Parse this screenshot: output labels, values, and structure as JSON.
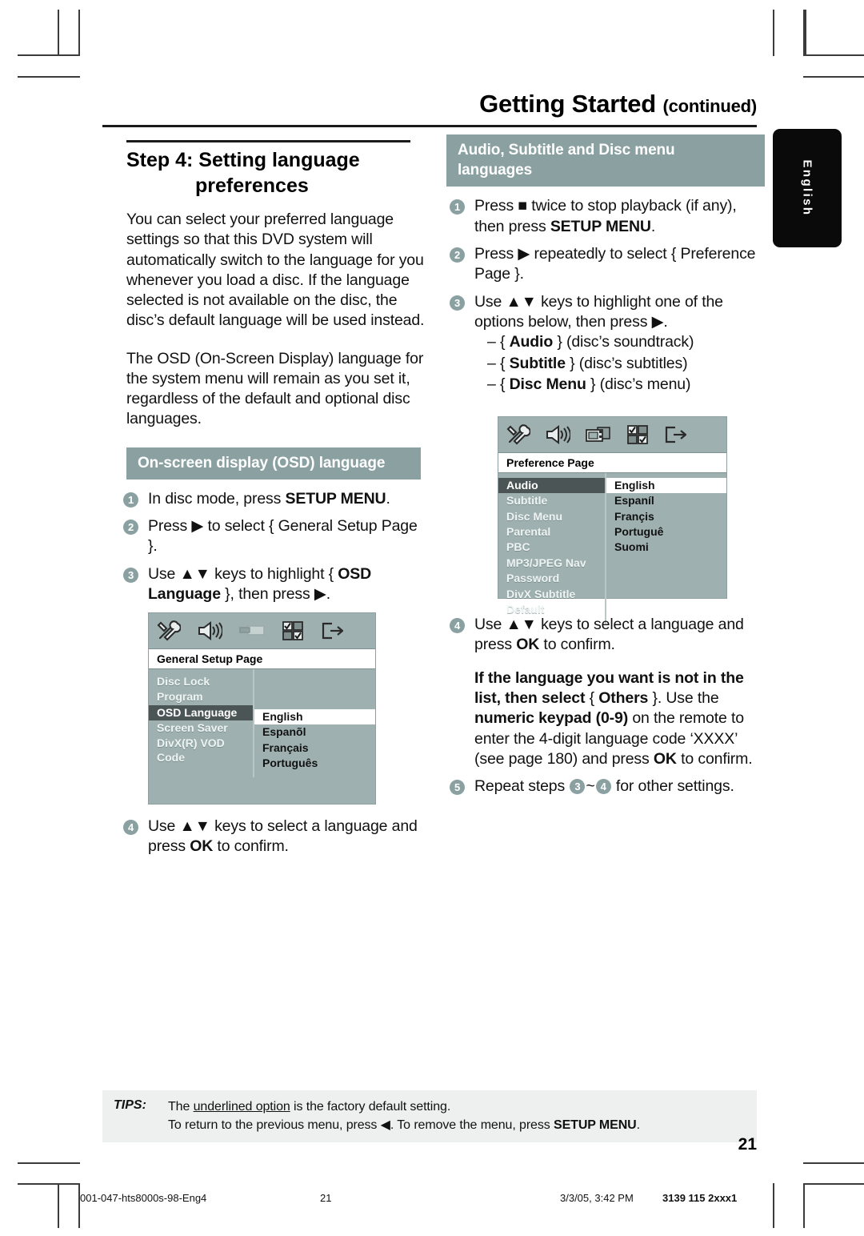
{
  "header": {
    "title": "Getting Started",
    "continued": "(continued)"
  },
  "english_tab": {
    "label": "English"
  },
  "left_column": {
    "step_heading_line1": "Step 4: Setting language",
    "step_heading_line2": "preferences",
    "paragraph_1": "You can select your preferred language settings so that this DVD system will automatically switch to the language for you whenever you load a disc.  If the language selected is not available on the disc, the disc’s default language will be used instead.",
    "paragraph_2": "The OSD (On-Screen Display) language for the system menu will remain as you set it, regardless of the default and optional disc languages.",
    "section_bar": "On-screen display (OSD) language",
    "steps": [
      {
        "num": "1",
        "html": "In disc mode, press <b>SETUP MENU</b>."
      },
      {
        "num": "2",
        "html": "Press ▶ to select { General Setup Page }."
      },
      {
        "num": "3",
        "html": "Use ▲▼ keys to highlight { <b>OSD Language</b> }, then press ▶."
      },
      {
        "num": "4",
        "html": "Use ▲▼ keys to select a language and press <b>OK</b> to confirm."
      }
    ]
  },
  "right_column": {
    "section_bar_line1": "Audio, Subtitle and Disc menu",
    "section_bar_line2": "languages",
    "steps": [
      {
        "num": "1",
        "html": "Press ■ twice to stop playback (if any), then press <b>SETUP MENU</b>."
      },
      {
        "num": "2",
        "html": "Press ▶ repeatedly to select { Preference Page }."
      },
      {
        "num": "3",
        "html": "Use ▲▼ keys to highlight one of the options below, then press ▶."
      }
    ],
    "step3_options": [
      "–  { <b>Audio</b> } (disc’s soundtrack)",
      "–  { <b>Subtitle</b> } (disc’s subtitles)",
      "–  { <b>Disc Menu</b> } (disc’s menu)"
    ],
    "step4": "Use ▲▼ keys to select a language and press <b>OK</b> to confirm.",
    "bold_note": "<b>If the language you want is not in the list, then select</b> { <b>Others</b> }. Use the <b>numeric keypad (0-9)</b> on the remote to enter the 4-digit language code ‘XXXX’ (see page 180) and press <b>OK</b> to confirm.",
    "step5_prefix": "Repeat steps",
    "step5_from": "3",
    "step5_sep": "~",
    "step5_to": "4",
    "step5_suffix": "for other settings."
  },
  "osd_general": {
    "title": "General Setup Page",
    "icons": [
      "tools-icon",
      "speaker-icon",
      "video-icon",
      "preferences-icon",
      "exit-icon"
    ],
    "menu_items": [
      "Disc Lock",
      "Program",
      "OSD Language",
      "Screen Saver",
      "DivX(R) VOD Code"
    ],
    "selected_item": "OSD Language",
    "options": [
      "English",
      "Espanõl",
      "Français",
      "Português"
    ],
    "selected_option": "English"
  },
  "osd_preference": {
    "title": "Preference Page",
    "icons": [
      "tools-icon",
      "speaker-icon",
      "video-icon",
      "preferences-icon",
      "exit-icon"
    ],
    "menu_items": [
      "Audio",
      "Subtitle",
      "Disc Menu",
      "Parental",
      "PBC",
      "MP3/JPEG Nav",
      "Password",
      "DivX Subtitle",
      "Default"
    ],
    "selected_item": "Audio",
    "options": [
      "English",
      "Espaníl",
      "Françis",
      "Portuguê",
      "Suomi"
    ],
    "selected_option": "English"
  },
  "tips": {
    "label": "TIPS:",
    "line1_pre": "The ",
    "line1_underlined": "underlined option",
    "line1_post": " is the factory default setting.",
    "line2": "To return to the previous menu, press ◀. To remove the menu, press <b>SETUP MENU</b>."
  },
  "page_number": "21",
  "footer": {
    "file": "001-047-hts8000s-98-Eng4",
    "page": "21",
    "date": "3/3/05, 3:42 PM",
    "code": "3139 115 2xxx1"
  },
  "colors": {
    "accent_bar": "#8ba1a1",
    "osd_bg": "#9fb0b0",
    "osd_selected": "#4b5555",
    "tips_bg": "#eef0ef"
  }
}
